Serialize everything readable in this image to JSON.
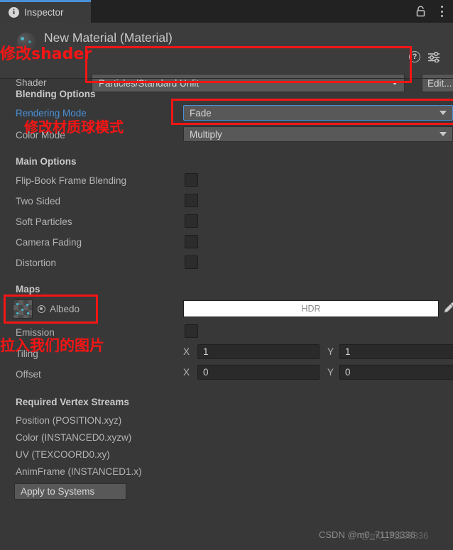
{
  "window": {
    "tab_label": "Inspector",
    "info_icon": "info-icon",
    "lock_icon": "lock-icon",
    "menu_icon": "kebab-menu-icon"
  },
  "header": {
    "material_title": "New Material (Material)",
    "help_icon": "?",
    "preset_icon": "preset-icon",
    "shader_label": "Shader",
    "shader_value": "Particles/Standard Unlit",
    "edit_label": "Edit..."
  },
  "blending": {
    "section_title": "Blending Options",
    "rendering_mode_label": "Rendering Mode",
    "rendering_mode_value": "Fade",
    "color_mode_label": "Color Mode",
    "color_mode_value": "Multiply"
  },
  "main_options": {
    "section_title": "Main Options",
    "rows": [
      {
        "label": "Flip-Book Frame Blending",
        "checked": false
      },
      {
        "label": "Two Sided",
        "checked": false
      },
      {
        "label": "Soft Particles",
        "checked": false
      },
      {
        "label": "Camera Fading",
        "checked": false
      },
      {
        "label": "Distortion",
        "checked": false
      }
    ]
  },
  "maps": {
    "section_title": "Maps",
    "albedo_label": "Albedo",
    "albedo_hdr_label": "HDR",
    "albedo_texture_icon": "texture-swatch-icon",
    "eyedropper_icon": "eyedropper-icon",
    "emission_label": "Emission",
    "emission_checked": false,
    "tiling_label": "Tiling",
    "tiling_x": "1",
    "tiling_y": "1",
    "offset_label": "Offset",
    "offset_x": "0",
    "offset_y": "0",
    "axis_x": "X",
    "axis_y": "Y"
  },
  "vertex_streams": {
    "section_title": "Required Vertex Streams",
    "items": [
      "Position (POSITION.xyz)",
      "Color (INSTANCED0.xyzw)",
      "UV (TEXCOORD0.xy)",
      "AnimFrame (INSTANCED1.x)"
    ],
    "apply_button": "Apply to Systems"
  },
  "annotations": {
    "shader_note": "修改shader",
    "rendering_mode_note": "修改材质球模式",
    "albedo_note": "拉入我们的图片",
    "box_color": "#f41515"
  },
  "watermark": {
    "text": "CSDN @m0_71193336",
    "overlay": "@m0_71193336"
  }
}
